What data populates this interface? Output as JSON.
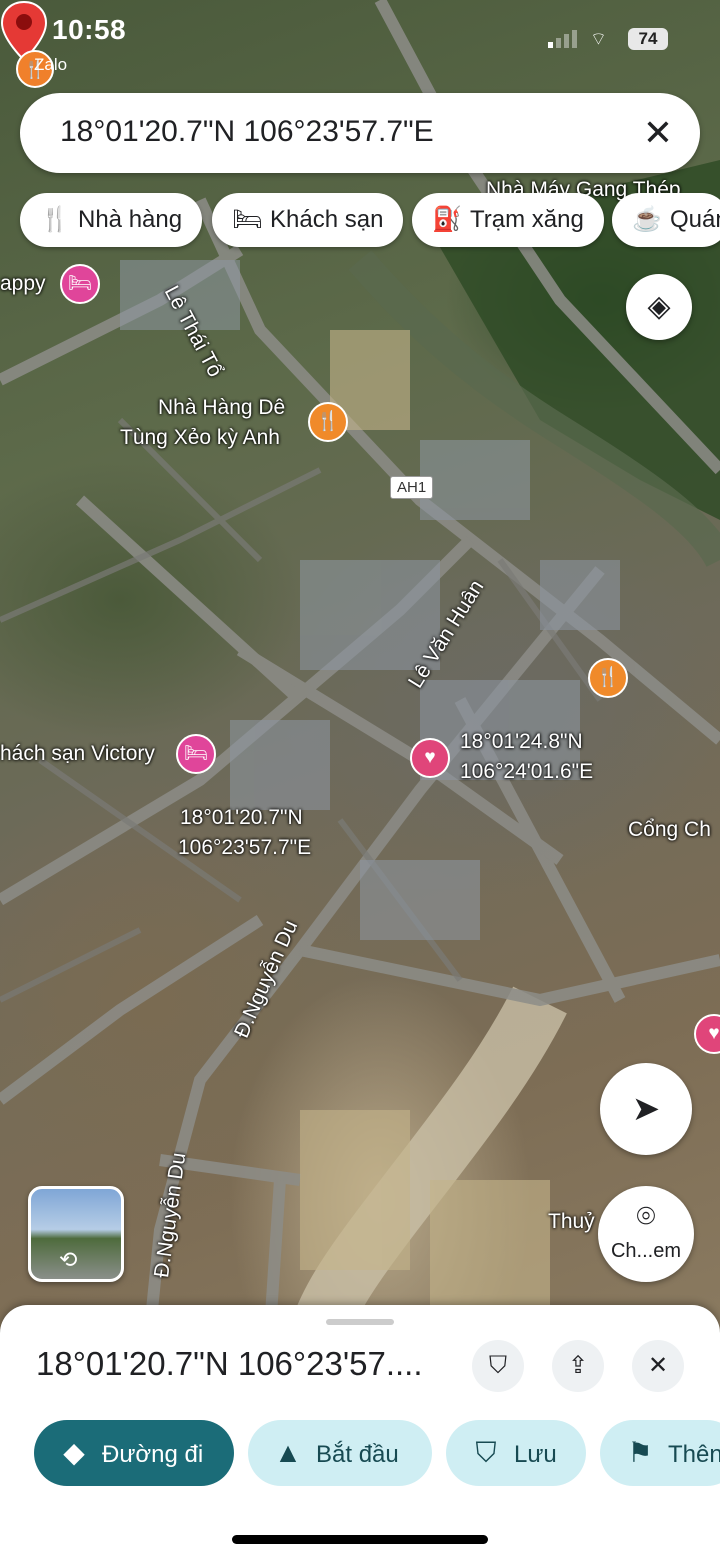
{
  "status_bar": {
    "time": "10:58",
    "back_app": "Zalo",
    "battery": "74"
  },
  "search": {
    "query": "18°01'20.7\"N 106°23'57.7\"E"
  },
  "chips": [
    {
      "label": "Nhà hàng",
      "icon": "restaurant-icon"
    },
    {
      "label": "Khách sạn",
      "icon": "bed-icon"
    },
    {
      "label": "Trạm xăng",
      "icon": "gas-station-icon"
    },
    {
      "label": "Quán",
      "icon": "coffee-icon"
    }
  ],
  "map": {
    "labels": {
      "factory": "Nhà Máy Gang Thép",
      "happy": "appy",
      "le_thai_to": "Lê Thái Tổ",
      "restaurant_line1": "Nhà Hàng Dê",
      "restaurant_line2": "Tùng Xẻo kỳ Anh",
      "ah1": "AH1",
      "le_van_huan": "Lê Văn Huân",
      "victory": "hách sạn Victory",
      "saved_line1": "18°01'24.8\"N",
      "saved_line2": "106°24'01.6\"E",
      "pin_line1": "18°01'20.7\"N",
      "pin_line2": "106°23'57.7\"E",
      "cong": "Cổng Ch",
      "nguyen_du_1": "Đ.Nguyễn Du",
      "nguyen_du_2": "Đ.Nguyễn Du",
      "thuy": "Thuỷ"
    },
    "lens_label": "Ch...em"
  },
  "sheet": {
    "title": "18°01'20.7\"N 106°23'57....",
    "buttons": {
      "directions": "Đường đi",
      "start": "Bắt đầu",
      "save": "Lưu",
      "more": "Thên"
    }
  },
  "colors": {
    "primary": "#1b6c78",
    "secondary_bg": "#cfeef3",
    "pin": "#e53935"
  }
}
